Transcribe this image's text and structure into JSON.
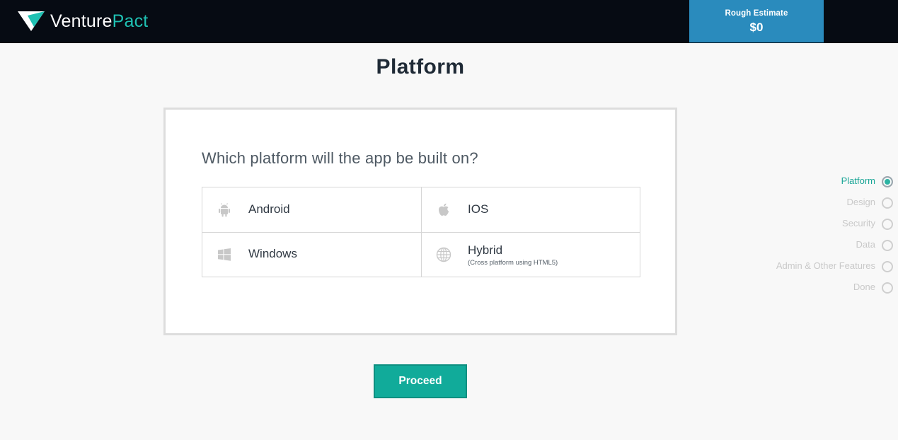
{
  "header": {
    "logo_prefix": "Venture",
    "logo_suffix": "Pact",
    "estimate_label": "Rough Estimate",
    "estimate_value": "$0",
    "colors": {
      "bar": "#060b13",
      "estimate": "#2a8bbd",
      "brand_accent": "#1fc1b3"
    }
  },
  "page": {
    "title": "Platform"
  },
  "question": "Which platform will the app be built on?",
  "options": [
    {
      "label": "Android",
      "sub": "",
      "icon": "android-icon"
    },
    {
      "label": "IOS",
      "sub": "",
      "icon": "apple-icon"
    },
    {
      "label": "Windows",
      "sub": "",
      "icon": "windows-icon"
    },
    {
      "label": "Hybrid",
      "sub": "(Cross platform using HTML5)",
      "icon": "globe-icon"
    }
  ],
  "proceed_label": "Proceed",
  "steps": [
    {
      "label": "Platform",
      "active": true
    },
    {
      "label": "Design",
      "active": false
    },
    {
      "label": "Security",
      "active": false
    },
    {
      "label": "Data",
      "active": false
    },
    {
      "label": "Admin & Other Features",
      "active": false
    },
    {
      "label": "Done",
      "active": false
    }
  ],
  "accent_color": "#11ab9a"
}
